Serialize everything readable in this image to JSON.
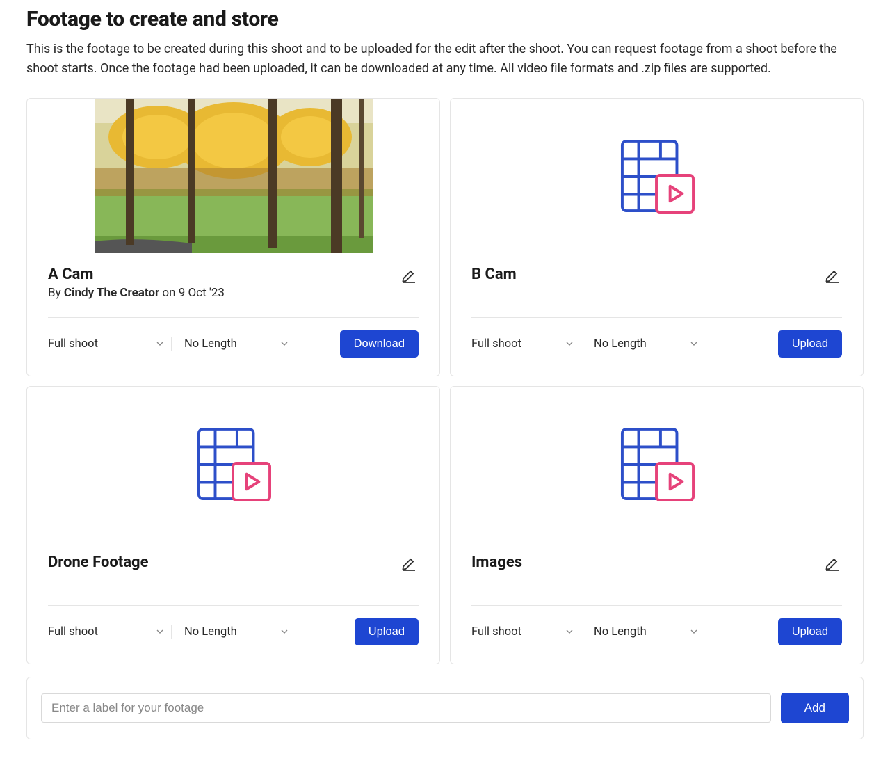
{
  "page": {
    "title": "Footage to create and store",
    "description": "This is the footage to be created during this shoot and to be uploaded for the edit after the shoot. You can request footage from a shoot before the shoot starts. Once the footage had been uploaded, it can be downloaded at any time. All video file formats and .zip files are supported."
  },
  "cards": [
    {
      "title": "A Cam",
      "byline_prefix": "By ",
      "author": "Cindy The Creator",
      "byline_suffix": " on 9 Oct '23",
      "shoot": "Full shoot",
      "length": "No Length",
      "action": "Download",
      "has_thumbnail": true
    },
    {
      "title": "B Cam",
      "shoot": "Full shoot",
      "length": "No Length",
      "action": "Upload",
      "has_thumbnail": false
    },
    {
      "title": "Drone Footage",
      "shoot": "Full shoot",
      "length": "No Length",
      "action": "Upload",
      "has_thumbnail": false
    },
    {
      "title": "Images",
      "shoot": "Full shoot",
      "length": "No Length",
      "action": "Upload",
      "has_thumbnail": false
    }
  ],
  "add": {
    "placeholder": "Enter a label for your footage",
    "button": "Add"
  },
  "colors": {
    "primary": "#1e46d2",
    "icon_blue": "#2d4fc9",
    "icon_pink": "#e6427a"
  }
}
